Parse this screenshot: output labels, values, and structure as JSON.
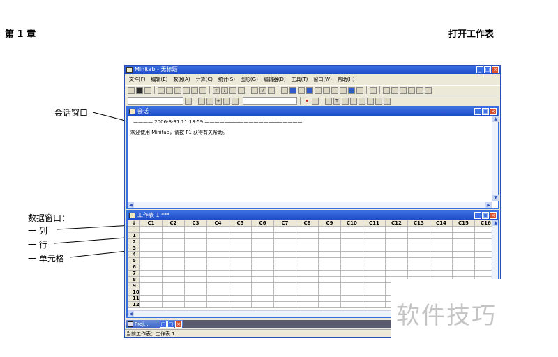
{
  "header": {
    "chapter": "第 1 章",
    "section": "打开工作表"
  },
  "callouts": {
    "session_window": "会话窗口",
    "data_window": "数据窗口：",
    "column": "一  列",
    "row": "一  行",
    "cell": "一  单元格"
  },
  "app": {
    "title": "Minitab - 无标题",
    "menu": [
      "文件(F)",
      "编辑(E)",
      "数据(A)",
      "计算(C)",
      "统计(S)",
      "图形(G)",
      "编辑器(D)",
      "工具(T)",
      "窗口(W)",
      "帮助(H)"
    ],
    "session": {
      "title": "会话",
      "timestamp_line": "————    2006-8-31 11:18:59    ————————————————————",
      "welcome": "欢迎使用 Minitab，请按 F1 获得有关帮助。"
    },
    "worksheet": {
      "title": "工作表 1 ***",
      "columns": [
        "C1",
        "C2",
        "C3",
        "C4",
        "C5",
        "C6",
        "C7",
        "C8",
        "C9",
        "C10",
        "C11",
        "C12",
        "C13",
        "C14",
        "C15",
        "C16"
      ],
      "rows": [
        "1",
        "2",
        "3",
        "4",
        "5",
        "6",
        "7",
        "8",
        "9",
        "10",
        "11",
        "12"
      ]
    },
    "minimized_window": "Proj...",
    "status": "当前工作表：工作表 1"
  },
  "watermark": "软件技巧",
  "colors": {
    "titlebar": "#1f4cc9",
    "chrome": "#ece9d8",
    "close_button": "#d8502c"
  }
}
